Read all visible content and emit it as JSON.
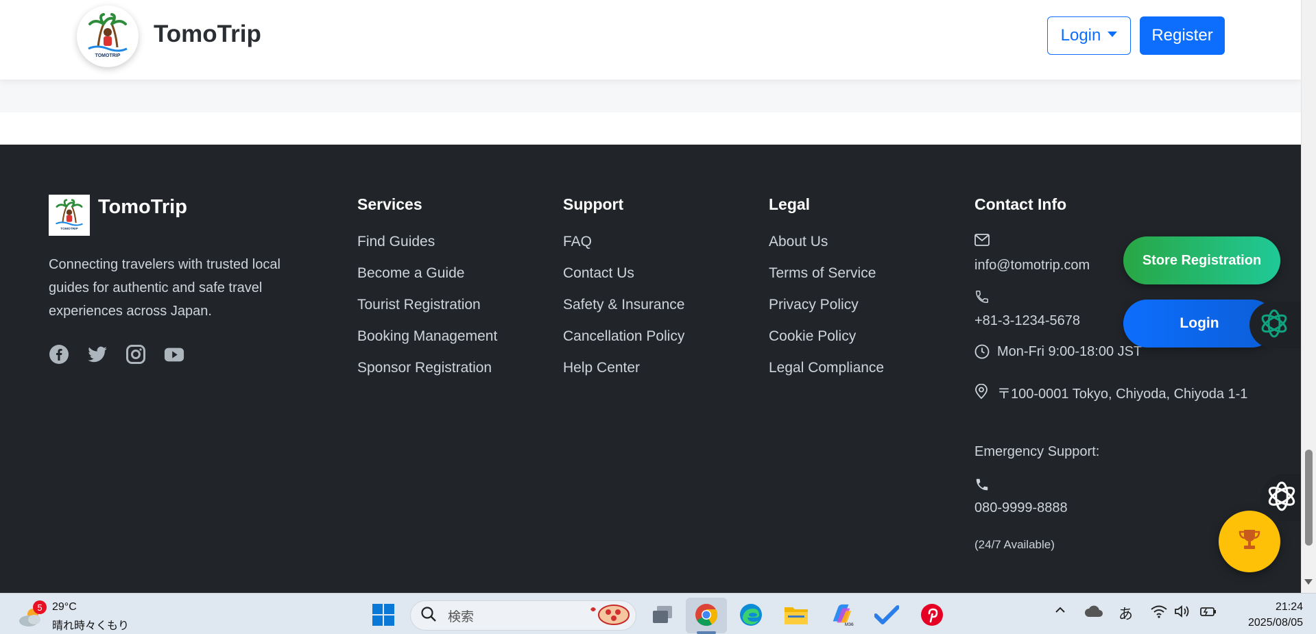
{
  "header": {
    "brand": "TomoTrip",
    "login_label": "Login",
    "register_label": "Register",
    "logo_caption": "TOMOTRIP"
  },
  "footer": {
    "brand": "TomoTrip",
    "tagline": "Connecting travelers with trusted local guides for authentic and safe travel experiences across Japan.",
    "social": [
      "facebook-icon",
      "twitter-icon",
      "instagram-icon",
      "youtube-icon"
    ],
    "services": {
      "title": "Services",
      "items": [
        "Find Guides",
        "Become a Guide",
        "Tourist Registration",
        "Booking Management",
        "Sponsor Registration"
      ]
    },
    "support": {
      "title": "Support",
      "items": [
        "FAQ",
        "Contact Us",
        "Safety & Insurance",
        "Cancellation Policy",
        "Help Center"
      ]
    },
    "legal": {
      "title": "Legal",
      "items": [
        "About Us",
        "Terms of Service",
        "Privacy Policy",
        "Cookie Policy",
        "Legal Compliance"
      ]
    },
    "contact": {
      "title": "Contact Info",
      "email": "info@tomotrip.com",
      "phone": "+81-3-1234-5678",
      "hours": "Mon-Fri 9:00-18:00 JST",
      "address": "〒100-0001 Tokyo, Chiyoda, Chiyoda 1-1",
      "emergency_label": "Emergency Support:",
      "emergency_phone": "080-9999-8888",
      "availability": "(24/7 Available)"
    }
  },
  "floating": {
    "store_registration": "Store Registration",
    "login": "Login"
  },
  "taskbar": {
    "weather_badge": "5",
    "temperature": "29°C",
    "condition": "晴れ時々くもり",
    "search_placeholder": "検索",
    "ime": "あ",
    "time": "21:24",
    "date": "2025/08/05"
  },
  "colors": {
    "primary": "#0d6efd",
    "footer_bg": "#212529",
    "store_green": "#28a745",
    "trophy_yellow": "#ffc107"
  }
}
